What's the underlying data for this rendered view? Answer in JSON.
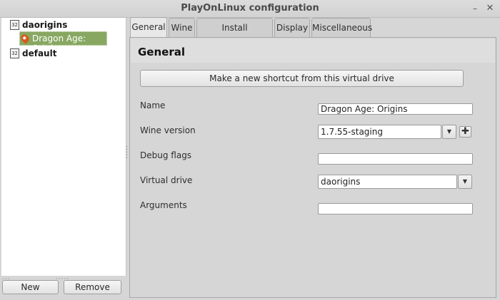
{
  "window": {
    "title": "PlayOnLinux configuration",
    "minimize_glyph": "–",
    "close_glyph": "✕"
  },
  "tree": {
    "prefixes": [
      {
        "label": "daorigins",
        "icon": "32bit-prefix-icon",
        "icon_text": "32"
      },
      {
        "label": "default",
        "icon": "32bit-prefix-icon",
        "icon_text": "32"
      }
    ],
    "selected_game": {
      "label": "Dragon Age:  Origins",
      "icon": "game-icon"
    }
  },
  "buttons": {
    "new_label": "New",
    "remove_label": "Remove"
  },
  "tabs": [
    {
      "label": "General",
      "active": true
    },
    {
      "label": "Wine",
      "active": false
    },
    {
      "label": "Install components",
      "active": false
    },
    {
      "label": "Display",
      "active": false
    },
    {
      "label": "Miscellaneous",
      "active": false
    }
  ],
  "general": {
    "title": "General",
    "shortcut_button": "Make a new shortcut from this virtual drive",
    "fields": {
      "name": {
        "label": "Name",
        "value": "Dragon Age:  Origins"
      },
      "wine_version": {
        "label": "Wine version",
        "value": "1.7.55-staging"
      },
      "debug_flags": {
        "label": "Debug flags",
        "value": ""
      },
      "virtual_drive": {
        "label": "Virtual drive",
        "value": "daorigins"
      },
      "arguments": {
        "label": "Arguments",
        "value": ""
      }
    },
    "add_glyph": "✚",
    "dropdown_glyph": "▼"
  },
  "colors": {
    "selection": "#88a862",
    "background": "#d6d6d6"
  }
}
